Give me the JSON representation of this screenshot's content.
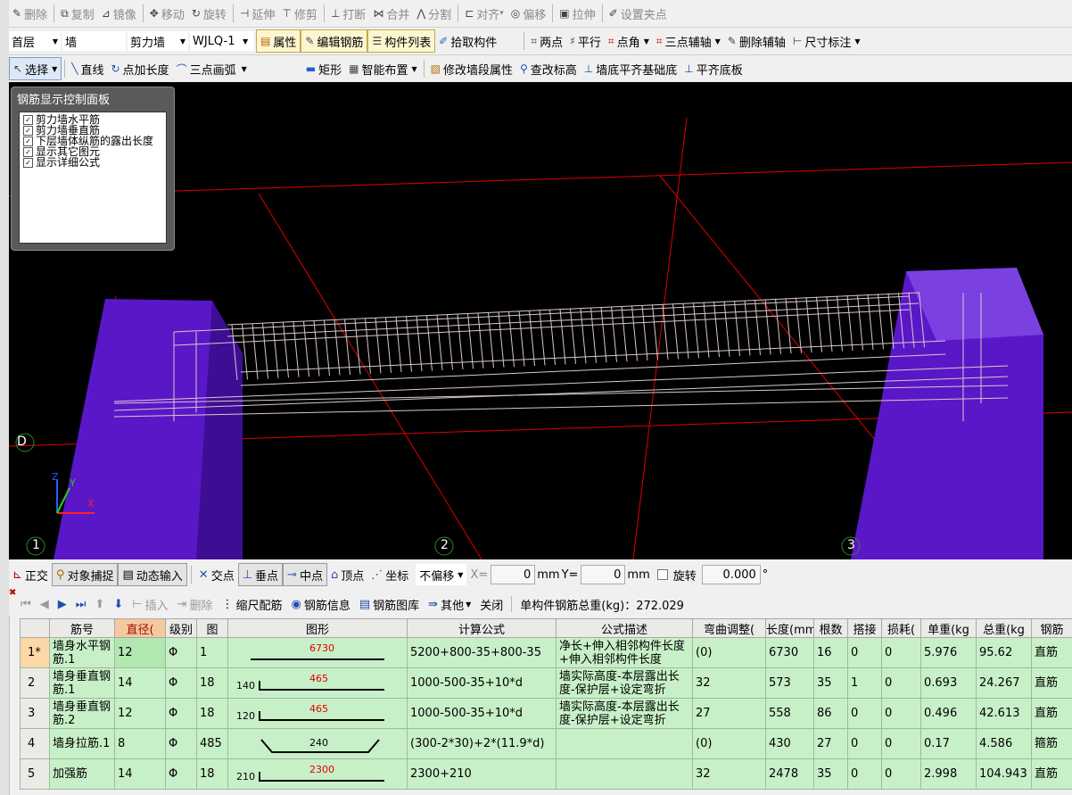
{
  "toolbar1": {
    "items": [
      {
        "label": "删除",
        "icon": "✎"
      },
      {
        "label": "复制",
        "icon": "⧉"
      },
      {
        "label": "镜像",
        "icon": "⊿"
      },
      {
        "label": "移动",
        "icon": "✥"
      },
      {
        "label": "旋转",
        "icon": "↻"
      },
      {
        "label": "延伸",
        "icon": "⊣"
      },
      {
        "label": "修剪",
        "icon": "⊤"
      },
      {
        "label": "打断",
        "icon": "⊥"
      },
      {
        "label": "合并",
        "icon": "⋈"
      },
      {
        "label": "分割",
        "icon": "⋀"
      },
      {
        "label": "对齐",
        "icon": "⊏"
      },
      {
        "label": "偏移",
        "icon": "◎"
      },
      {
        "label": "拉伸",
        "icon": "▣"
      },
      {
        "label": "设置夹点",
        "icon": "✐"
      }
    ]
  },
  "toolbar2": {
    "floor": "首层",
    "category": "墙",
    "type": "剪力墙",
    "name": "WJLQ-1",
    "property_btn": "属性",
    "edit_rebar_btn": "编辑钢筋",
    "component_list_btn": "构件列表",
    "pick_btn": "拾取构件",
    "two_point": "两点",
    "parallel": "平行",
    "point_angle": "点角",
    "three_point_axis": "三点辅轴",
    "delete_axis": "删除辅轴",
    "dim": "尺寸标注"
  },
  "toolbar3": {
    "select": "选择",
    "line": "直线",
    "point_length": "点加长度",
    "three_arc": "三点画弧",
    "rect": "矩形",
    "smart": "智能布置",
    "modify_wall": "修改墙段属性",
    "check_elev": "查改标高",
    "wall_bottom": "墙底平齐基础底",
    "flush_slab": "平齐底板"
  },
  "panel": {
    "title": "钢筋显示控制面板",
    "items": [
      "剪力墙水平筋",
      "剪力墙垂直筋",
      "下层墙体纵筋的露出长度",
      "显示其它图元",
      "显示详细公式"
    ]
  },
  "viewport": {
    "axis_labels": [
      "D",
      "1",
      "2",
      "3"
    ],
    "axes": [
      "Z",
      "Y",
      "X"
    ]
  },
  "statusbar": {
    "ortho": "正交",
    "snap": "对象捕捉",
    "dynamic": "动态输入",
    "intersect": "交点",
    "perp": "垂点",
    "mid": "中点",
    "vertex": "顶点",
    "coord": "坐标",
    "offset": "不偏移",
    "x_label": "X=",
    "x_value": "0",
    "mm": "mm",
    "y_label": "Y=",
    "y_value": "0",
    "rotate": "旋转",
    "rotate_value": "0.000",
    "deg": "°"
  },
  "grid_toolbar": {
    "insert": "插入",
    "delete": "删除",
    "scale": "缩尺配筋",
    "info": "钢筋信息",
    "library": "钢筋图库",
    "other": "其他",
    "close": "关闭",
    "total": "单构件钢筋总重(kg)：272.029"
  },
  "grid": {
    "headers": [
      "筋号",
      "直径(",
      "级别",
      "图",
      "图形",
      "计算公式",
      "公式描述",
      "弯曲调整(",
      "长度(mm",
      "根数",
      "搭接",
      "损耗(",
      "单重(kg",
      "总重(kg",
      "钢筋"
    ],
    "rows": [
      {
        "rn": "1*",
        "name": "墙身水平钢筋.1",
        "dia": "12",
        "grade": "Φ",
        "fig": "1",
        "shape": {
          "kind": "straight",
          "mid": "6730",
          "left": "",
          "right": ""
        },
        "formula": "5200+800-35+800-35",
        "desc": "净长+伸入相邻构件长度+伸入相邻构件长度",
        "bend": "(0)",
        "length": "6730",
        "count": "16",
        "lap": "0",
        "loss": "0",
        "unit_w": "5.976",
        "total_w": "95.62",
        "type": "直筋"
      },
      {
        "rn": "2",
        "name": "墙身垂直钢筋.1",
        "dia": "14",
        "grade": "Φ",
        "fig": "18",
        "shape": {
          "kind": "hook",
          "mid": "465",
          "left": "140",
          "right": ""
        },
        "formula": "1000-500-35+10*d",
        "desc": "墙实际高度-本层露出长度-保护层+设定弯折",
        "bend": "32",
        "length": "573",
        "count": "35",
        "lap": "1",
        "loss": "0",
        "unit_w": "0.693",
        "total_w": "24.267",
        "type": "直筋"
      },
      {
        "rn": "3",
        "name": "墙身垂直钢筋.2",
        "dia": "12",
        "grade": "Φ",
        "fig": "18",
        "shape": {
          "kind": "hook",
          "mid": "465",
          "left": "120",
          "right": ""
        },
        "formula": "1000-500-35+10*d",
        "desc": "墙实际高度-本层露出长度-保护层+设定弯折",
        "bend": "27",
        "length": "558",
        "count": "86",
        "lap": "0",
        "loss": "0",
        "unit_w": "0.496",
        "total_w": "42.613",
        "type": "直筋"
      },
      {
        "rn": "4",
        "name": "墙身拉筋.1",
        "dia": "8",
        "grade": "Φ",
        "fig": "485",
        "shape": {
          "kind": "tie",
          "mid": "240",
          "left": "",
          "right": ""
        },
        "formula": "(300-2*30)+2*(11.9*d)",
        "desc": "",
        "bend": "(0)",
        "length": "430",
        "count": "27",
        "lap": "0",
        "loss": "0",
        "unit_w": "0.17",
        "total_w": "4.586",
        "type": "箍筋"
      },
      {
        "rn": "5",
        "name": "加强筋",
        "dia": "14",
        "grade": "Φ",
        "fig": "18",
        "shape": {
          "kind": "hook",
          "mid": "2300",
          "left": "210",
          "right": ""
        },
        "formula": "2300+210",
        "desc": "",
        "bend": "32",
        "length": "2478",
        "count": "35",
        "lap": "0",
        "loss": "0",
        "unit_w": "2.998",
        "total_w": "104.943",
        "type": "直筋"
      }
    ]
  },
  "colors": {
    "column": "#5a17c8",
    "grid_line": "#e00000",
    "rebar": "#d8c8c8",
    "row_bg": "#c8f0c8"
  }
}
